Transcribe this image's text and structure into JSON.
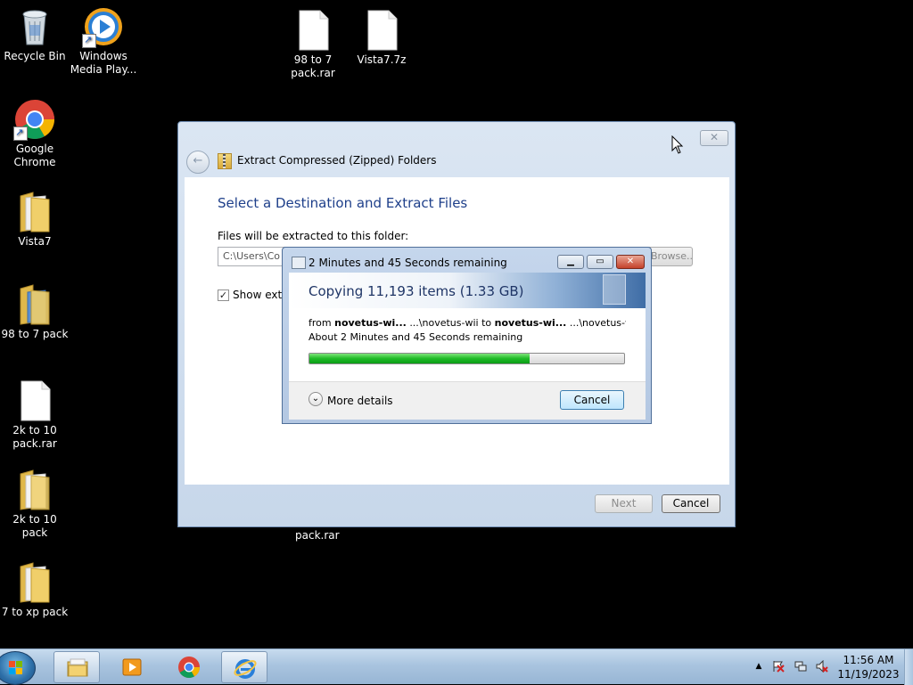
{
  "desktop": {
    "icons": [
      {
        "label": "Recycle Bin"
      },
      {
        "label": "Windows Media Play..."
      },
      {
        "label": "98 to 7 pack.rar"
      },
      {
        "label": "Vista7.7z"
      },
      {
        "label": "Google Chrome"
      },
      {
        "label": "Vista7"
      },
      {
        "label": "98 to 7 pack"
      },
      {
        "label": "2k to 10 pack.rar"
      },
      {
        "label": "2k to 10 pack"
      },
      {
        "label": "7 to xp pack"
      }
    ],
    "partial_label": "pack.rar"
  },
  "wizard": {
    "title": "Extract Compressed (Zipped) Folders",
    "heading": "Select a Destination and Extract Files",
    "path_label": "Files will be extracted to this folder:",
    "path_value": "C:\\Users\\Co",
    "browse_label": "Browse...",
    "show_checkbox_mark": "✓",
    "show_label": "Show extracted files when complete",
    "next_label": "Next",
    "cancel_label": "Cancel",
    "close_glyph": "✕",
    "back_glyph": "←"
  },
  "copy_dialog": {
    "title": "2 Minutes and 45 Seconds remaining",
    "banner": "Copying 11,193 items (1.33 GB)",
    "from_word": "from",
    "from_name": "novetus-wi...",
    "from_path": "...\\novetus-wii",
    "to_word": "to",
    "to_name": "novetus-wi...",
    "to_path": "...\\novetus-wi",
    "remaining": "About 2 Minutes and 45 Seconds remaining",
    "progress": 0.7,
    "more_details": "More details",
    "cancel_label": "Cancel",
    "chevron": "⌄",
    "min_glyph": "▁",
    "max_glyph": "▭",
    "close_glyph": "✕"
  },
  "taskbar": {
    "time": "11:56 AM",
    "date": "11/19/2023",
    "tray_arrow": "▲",
    "tray_icons": [
      "flag-icon",
      "network-icon",
      "volume-muted-icon"
    ],
    "pinned": [
      "file-explorer-icon",
      "media-player-icon",
      "chrome-icon",
      "internet-explorer-icon"
    ]
  },
  "colors": {
    "desktop": "#000000",
    "progress": "#1fbb27",
    "heading": "#1e3f8a"
  }
}
